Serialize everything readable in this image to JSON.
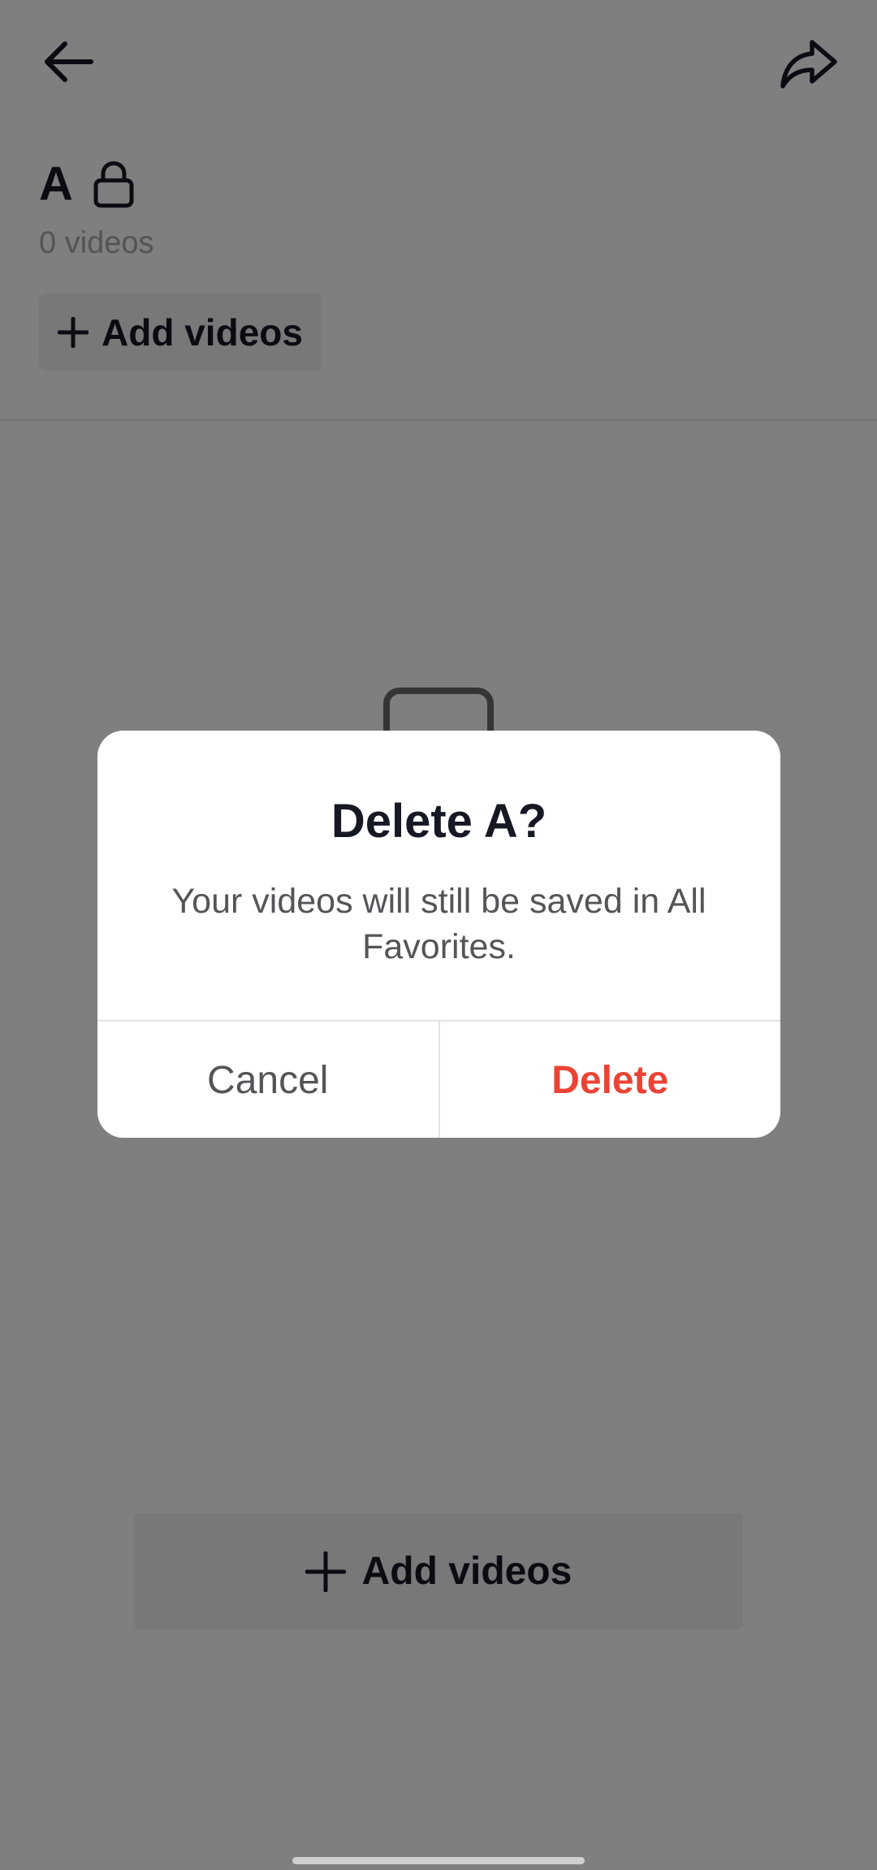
{
  "header": {
    "back_icon": "arrow-left-icon",
    "share_icon": "share-arrow-icon"
  },
  "collection": {
    "title": "A",
    "privacy_icon": "lock-icon",
    "video_count": "0 videos",
    "add_videos_label": "Add videos"
  },
  "empty_state": {
    "add_videos_label": "Add videos"
  },
  "dialog": {
    "title": "Delete A?",
    "message": "Your videos will still be saved in All Favorites.",
    "cancel_label": "Cancel",
    "delete_label": "Delete",
    "delete_color": "#ea4335"
  },
  "colors": {
    "primary_text": "#161823",
    "secondary_text": "#a7a8ad",
    "button_bg": "#f1f1f2",
    "overlay": "rgba(0,0,0,0.5)"
  }
}
